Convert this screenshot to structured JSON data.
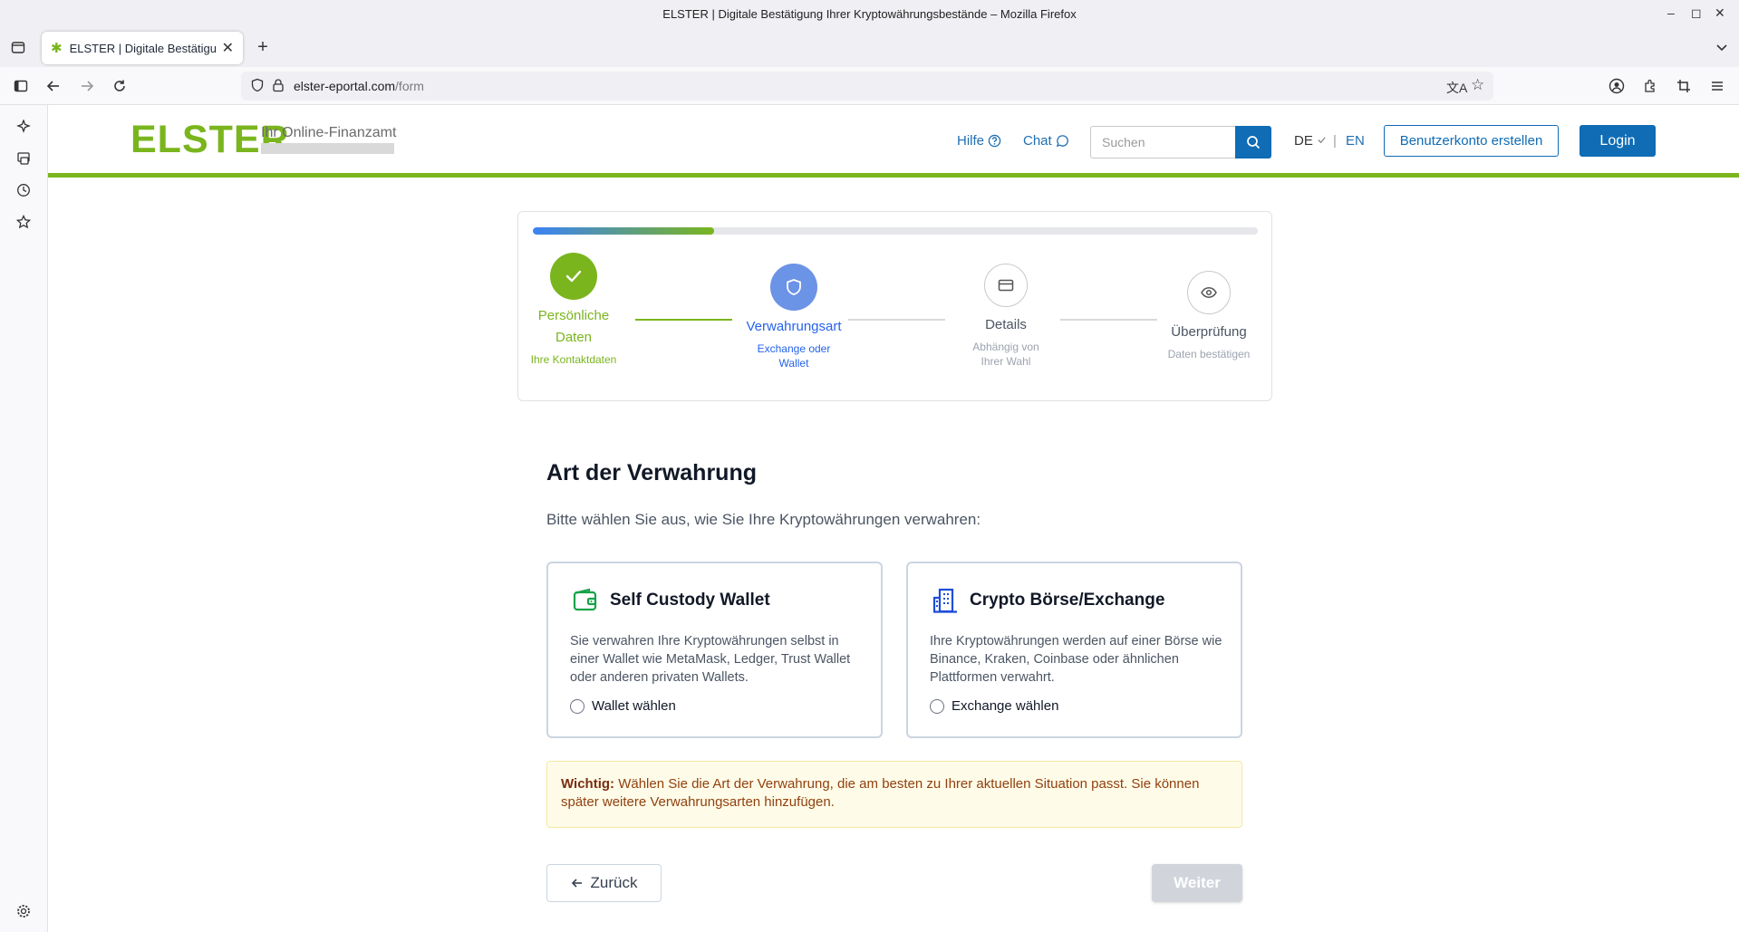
{
  "window": {
    "title": "ELSTER | Digitale Bestätigung Ihrer Kryptowährungsbestände – Mozilla Firefox"
  },
  "tab": {
    "label": "ELSTER | Digitale Bestätigung Ihrer Kryptowährungsbestände"
  },
  "url": {
    "host": "elster-eportal.com",
    "path": "/form"
  },
  "header": {
    "logo": "ELSTER",
    "subtitle": "Ihr Online-Finanzamt",
    "help": "Hilfe",
    "chat": "Chat",
    "search_placeholder": "Suchen",
    "lang_de": "DE",
    "lang_sep": "|",
    "lang_en": "EN",
    "register": "Benutzerkonto erstellen",
    "login": "Login"
  },
  "progress": {
    "fill_fraction": 0.25,
    "steps": [
      {
        "title": "Persönliche Daten",
        "desc": "Ihre Kontaktdaten",
        "state": "done"
      },
      {
        "title": "Verwahrungsart",
        "desc": "Exchange oder Wallet",
        "state": "active"
      },
      {
        "title": "Details",
        "desc": "Abhängig von Ihrer Wahl",
        "state": "pending"
      },
      {
        "title": "Überprüfung",
        "desc": "Daten bestätigen",
        "state": "pending"
      }
    ]
  },
  "content": {
    "title": "Art der Verwahrung",
    "intro": "Bitte wählen Sie aus, wie Sie Ihre Kryptowährungen verwahren:",
    "options": [
      {
        "title": "Self Custody Wallet",
        "desc": "Sie verwahren Ihre Kryptowährungen selbst in einer Wallet wie MetaMask, Ledger, Trust Wallet oder anderen privaten Wallets.",
        "radio": "Wallet wählen",
        "icon": "wallet-icon",
        "icon_color": "#16a34a"
      },
      {
        "title": "Crypto Börse/Exchange",
        "desc": "Ihre Kryptowährungen werden auf einer Börse wie Binance, Kraken, Coinbase oder ähnlichen Plattformen verwahrt.",
        "radio": "Exchange wählen",
        "icon": "building-icon",
        "icon_color": "#1d4ed8"
      }
    ],
    "note_label": "Wichtig:",
    "note_text": " Wählen Sie die Art der Verwahrung, die am besten zu Ihrer aktuellen Situation passt. Sie können später weitere Verwahrungsarten hinzufügen.",
    "back": "Zurück",
    "next": "Weiter"
  },
  "colors": {
    "brand_green": "#7ab51d",
    "brand_blue": "#0f6cb5",
    "step_active": "#6b93e6"
  }
}
